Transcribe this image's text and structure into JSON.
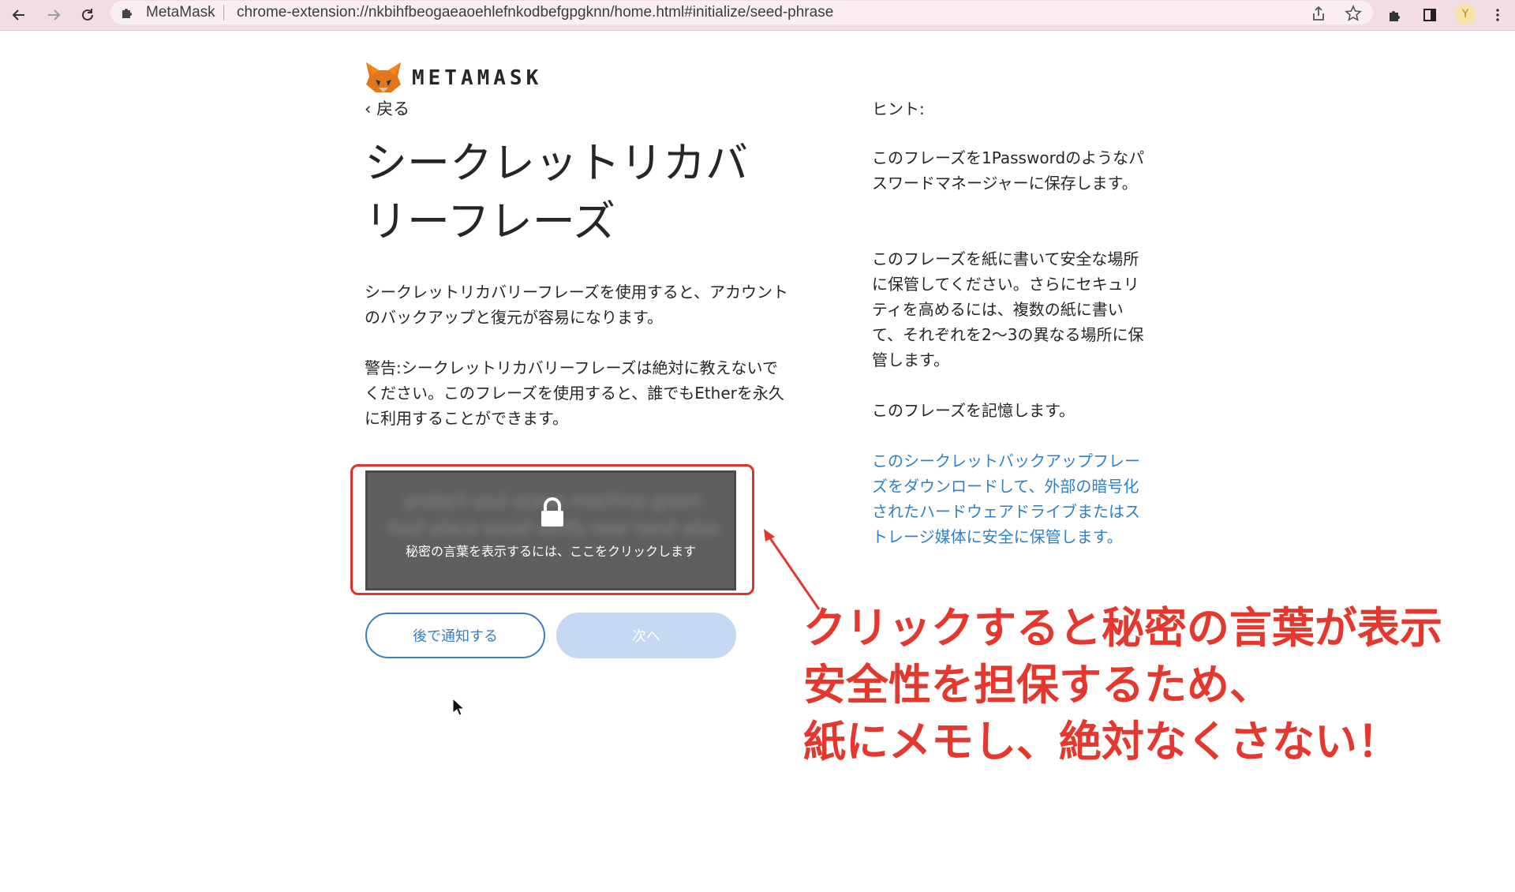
{
  "browser": {
    "site_name": "MetaMask",
    "url": "chrome-extension://nkbihfbeogaeaoehlefnkodbefgpgknn/home.html#initialize/seed-phrase",
    "avatar_letter": "Y"
  },
  "page": {
    "brand": "METAMASK",
    "back_label": "‹ 戻る",
    "title": "シークレットリカバリーフレーズ",
    "description": "シークレットリカバリーフレーズを使用すると、アカウントのバックアップと復元が容易になります。",
    "warning": "警告:シークレットリカバリーフレーズは絶対に教えないでください。このフレーズを使用すると、誰でもEtherを永久に利用することができます。",
    "reveal_text": "秘密の言葉を表示するには、ここをクリックします",
    "blurred_words": "protect soul ocean machine green host place avoid verify near twist also",
    "remind_later_label": "後で通知する",
    "next_label": "次へ"
  },
  "hints": {
    "heading": "ヒント:",
    "tip1": "このフレーズを1Passwordのようなパスワードマネージャーに保存します。",
    "tip2": "このフレーズを紙に書いて安全な場所に保管してください。さらにセキュリティを高めるには、複数の紙に書いて、それぞれを2〜3の異なる場所に保管します。",
    "tip3": "このフレーズを記憶します。",
    "download_link": "このシークレットバックアップフレーズをダウンロードして、外部の暗号化されたハードウェアドライブまたはストレージ媒体に安全に保管します。"
  },
  "annotation": {
    "line1": "クリックすると秘密の言葉が表示",
    "line2": "安全性を担保するため、",
    "line3": "紙にメモし、絶対なくさない！"
  },
  "colors": {
    "annotation_red": "#e4372d",
    "link_blue": "#2f7fcb",
    "button_blue": "#3a7cc5",
    "disabled_button": "#c4d8f2"
  }
}
